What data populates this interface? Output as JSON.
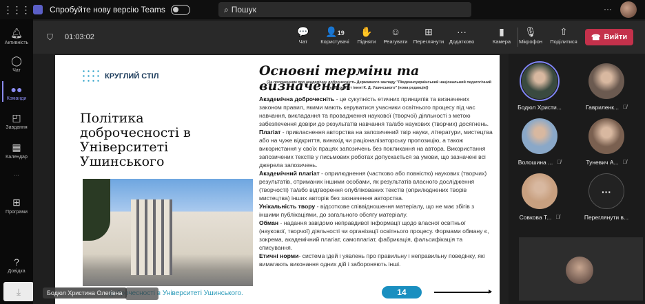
{
  "topbar": {
    "try_new": "Спробуйте нову версію Teams",
    "search_placeholder": "Пошук",
    "more": "···"
  },
  "rail": [
    {
      "label": "Активність",
      "icon": "bell-icon"
    },
    {
      "label": "Чат",
      "icon": "chat-icon"
    },
    {
      "label": "Команди",
      "icon": "teams-icon",
      "active": true
    },
    {
      "label": "Завдання",
      "icon": "backpack-icon"
    },
    {
      "label": "Календар",
      "icon": "calendar-icon"
    },
    {
      "label": "···",
      "icon": "more-icon"
    },
    {
      "label": "Програми",
      "icon": "apps-icon"
    },
    {
      "label": "Довідка",
      "icon": "help-icon"
    }
  ],
  "meeting": {
    "timer": "01:03:02",
    "controls": [
      {
        "label": "Чат",
        "icon": "chat-icon",
        "glyph": "💬"
      },
      {
        "label": "Користувачі",
        "icon": "people-icon",
        "glyph": "👤",
        "count": "19"
      },
      {
        "label": "Підняти",
        "icon": "raise-hand-icon",
        "glyph": "✋"
      },
      {
        "label": "Реагувати",
        "icon": "smile-icon",
        "glyph": "☺"
      },
      {
        "label": "Переглянути",
        "icon": "view-grid-icon",
        "glyph": "⊞"
      },
      {
        "label": "Додатково",
        "icon": "more-icon",
        "glyph": "···"
      },
      {
        "label": "Камера",
        "icon": "camera-off-icon",
        "glyph": "▮"
      },
      {
        "label": "Мікрофон",
        "icon": "mic-off-icon",
        "glyph": "🎙"
      },
      {
        "label": "Поділитися",
        "icon": "share-icon",
        "glyph": "⇧"
      }
    ],
    "leave": "Вийти",
    "leave_color": "#c4314b"
  },
  "slide": {
    "logo": "КРУГЛИЙ СТІЛ",
    "left_title": "Політика доброчесності в Університеті Ушинського",
    "footer": "...доброчесності в Університеті Ушинського.",
    "title": "Основні терміни та визначення",
    "subtitle": "(За положенням про академічну доброчесність Державного закладу \"Південноукраїнський національний педагогічний університет імені К. Д. Ушинського\" (нова редакція))",
    "terms": [
      {
        "term": "Академічна доброчесніть",
        "def": " - це сукупність етичних принципів та визначених законом правил, якими мають керуватися учасники освітнього процесу під час навчання, викладання та провадження наукової (творчої) діяльності з метою забезпечення довіри до результатів навчання та/або наукових (творчих) досягнень."
      },
      {
        "term": "Плагіат",
        "def": " - привласнення авторства на запозичений твір науки, літератури, мистецтва або на чуже відкриття, винахід чи раціоналізаторську пропозицію, а також використання у своїх працях запозичень без покликання на автора. Використання запозичених текстів у письмових роботах допускається за умови, що зазначені всі джерела запозичень."
      },
      {
        "term": "Академічний плагіат",
        "def": " - оприлюднення (частково або повністю) наукових (творчих) результатів, отриманих іншими особами, як результатів власного дослідження (творчості) та/або відтворення опублікованих текстів (оприлюднених творів мистецтва) інших авторів без зазначення авторства."
      },
      {
        "term": "Унікальність твору",
        "def": " - відсоткове співвідношення матеріалу, що не має збігів з іншими публікаціями, до загального обсягу матеріалу."
      },
      {
        "term": "Обман",
        "def": " - надання завідомо неправдивої інформації щодо власної освітньої (наукової, творчої) діяльності чи організації освітнього процесу. Формами обману є, зокрема, академічний плагіат, самоплагіат, фабрикація, фальсифікація та списування."
      },
      {
        "term": "Етичні норми",
        "def": "- система ідей і уявлень про правильну і неправильну поведінку, які вимагають виконання одних дій і забороняють інші."
      }
    ],
    "page": "14"
  },
  "presenter_name": "Бодюл Христина Олегівна",
  "participants": [
    {
      "name": "Бодюл Христи...",
      "muted": false,
      "speaking": true,
      "color": "#3a4a40"
    },
    {
      "name": "Гавриленк...",
      "muted": true,
      "color": "#6b5a50"
    },
    {
      "name": "Волошина ...",
      "muted": true,
      "color": "#8aa8c8"
    },
    {
      "name": "Туневич А...",
      "muted": true,
      "color": "#7a6050"
    },
    {
      "name": "Совкова Т...",
      "muted": true,
      "color": "#c8a080"
    },
    {
      "name": "Переглянути в...",
      "more": true,
      "label": "···"
    }
  ]
}
